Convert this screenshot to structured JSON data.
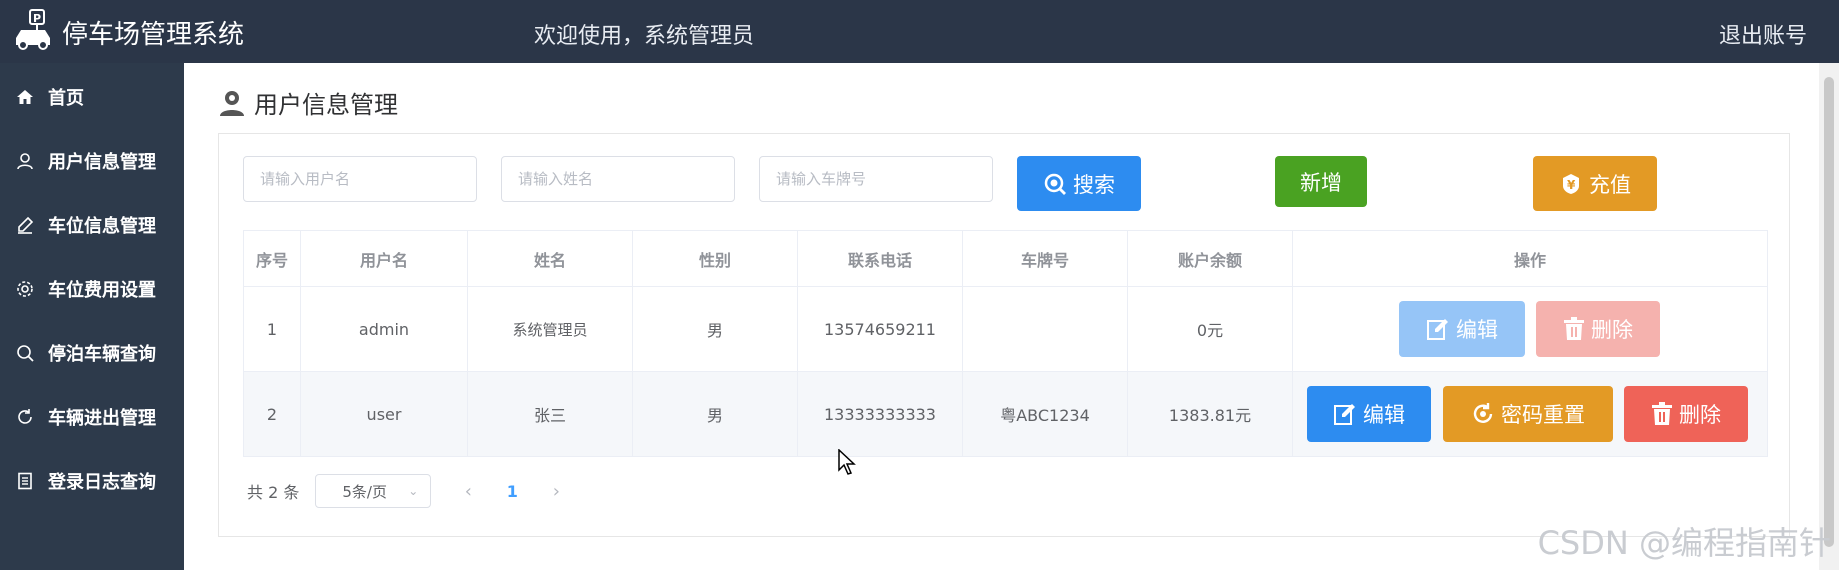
{
  "header": {
    "app_title": "停车场管理系统",
    "welcome": "欢迎使用，系统管理员",
    "logout": "退出账号"
  },
  "sidebar": {
    "items": [
      {
        "label": "首页",
        "icon": "home-icon"
      },
      {
        "label": "用户信息管理",
        "icon": "user-icon"
      },
      {
        "label": "车位信息管理",
        "icon": "edit-icon"
      },
      {
        "label": "车位费用设置",
        "icon": "gear-icon"
      },
      {
        "label": "停泊车辆查询",
        "icon": "search-icon"
      },
      {
        "label": "车辆进出管理",
        "icon": "refresh-icon"
      },
      {
        "label": "登录日志查询",
        "icon": "document-icon"
      }
    ]
  },
  "page": {
    "title": "用户信息管理"
  },
  "filters": {
    "username_placeholder": "请输入用户名",
    "name_placeholder": "请输入姓名",
    "plate_placeholder": "请输入车牌号",
    "search_label": "搜索",
    "add_label": "新增",
    "recharge_label": "充值"
  },
  "table": {
    "headers": [
      "序号",
      "用户名",
      "姓名",
      "性别",
      "联系电话",
      "车牌号",
      "账户余额",
      "操作"
    ],
    "rows": [
      {
        "index": "1",
        "username": "admin",
        "name": "系统管理员",
        "gender": "男",
        "phone": "13574659211",
        "plate": "",
        "balance": "0元"
      },
      {
        "index": "2",
        "username": "user",
        "name": "张三",
        "gender": "男",
        "phone": "13333333333",
        "plate": "粤ABC1234",
        "balance": "1383.81元"
      }
    ],
    "actions": {
      "edit": "编辑",
      "delete": "删除",
      "reset_password": "密码重置"
    }
  },
  "pagination": {
    "total": "共 2 条",
    "page_size": "5条/页",
    "current_page": "1"
  },
  "watermark": "CSDN @编程指南针",
  "colors": {
    "sidebar_bg": "#2d3a4b",
    "primary": "#2d8cf0",
    "success": "#4aa222",
    "warning": "#e39a25",
    "danger": "#ef6358"
  }
}
